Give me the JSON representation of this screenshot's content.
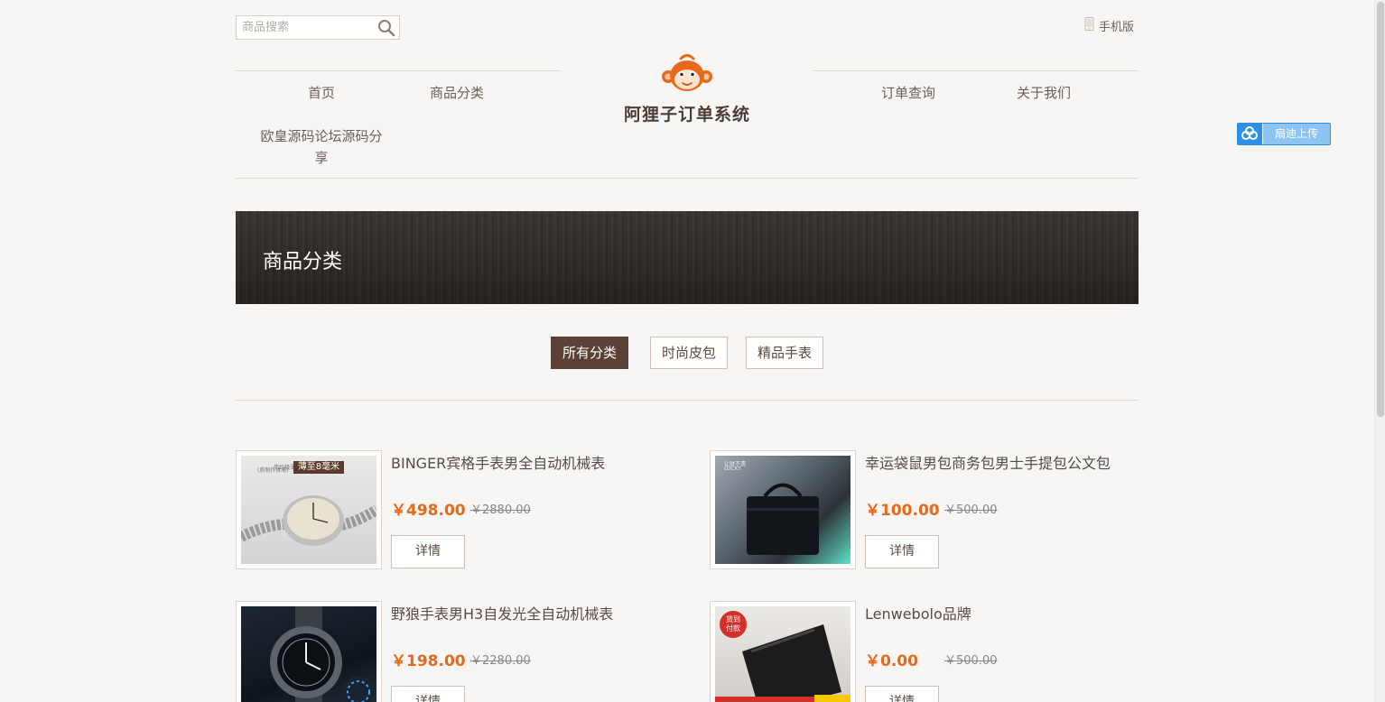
{
  "header": {
    "search_placeholder": "商品搜索",
    "mobile_label": "手机版",
    "brand": "阿狸子订单系统"
  },
  "nav": {
    "left": [
      "首页",
      "商品分类"
    ],
    "right": [
      "订单查询",
      "关于我们"
    ],
    "extra": [
      "欧皇源码论坛源码分",
      "享"
    ]
  },
  "cloud_button": {
    "label": "扇迪上传"
  },
  "banner": {
    "title": "商品分类"
  },
  "tabs": [
    {
      "label": "所有分类",
      "active": true
    },
    {
      "label": "时尚皮包",
      "active": false
    },
    {
      "label": "精品手表",
      "active": false
    }
  ],
  "products": [
    {
      "name": "BINGER宾格手表男全自动机械表",
      "price": "￥498.00",
      "old_price": "￥2880.00",
      "detail_label": "详情",
      "image_text": [
        "简约极薄设计 · 整合至精半透",
        "(质制作体笔)",
        "薄至8毫米"
      ]
    },
    {
      "name": "幸运袋鼠男包商务包男士手提包公文包",
      "price": "￥100.00",
      "old_price": "￥500.00",
      "detail_label": "详情",
      "image_text": [
        "让财不遗",
        "LUCKY"
      ]
    },
    {
      "name": "野狼手表男H3自发光全自动机械表",
      "price": "￥198.00",
      "old_price": "￥2280.00",
      "detail_label": "详情",
      "image_text": []
    },
    {
      "name": "Lenwebolo品牌",
      "price": "￥0.00",
      "old_price": "￥500.00",
      "detail_label": "详情",
      "image_text": [
        "货到",
        "付款"
      ]
    }
  ],
  "colors": {
    "accent_price": "#e8691a",
    "active_tab": "#5b4036",
    "logo_orange": "#e8691a"
  }
}
